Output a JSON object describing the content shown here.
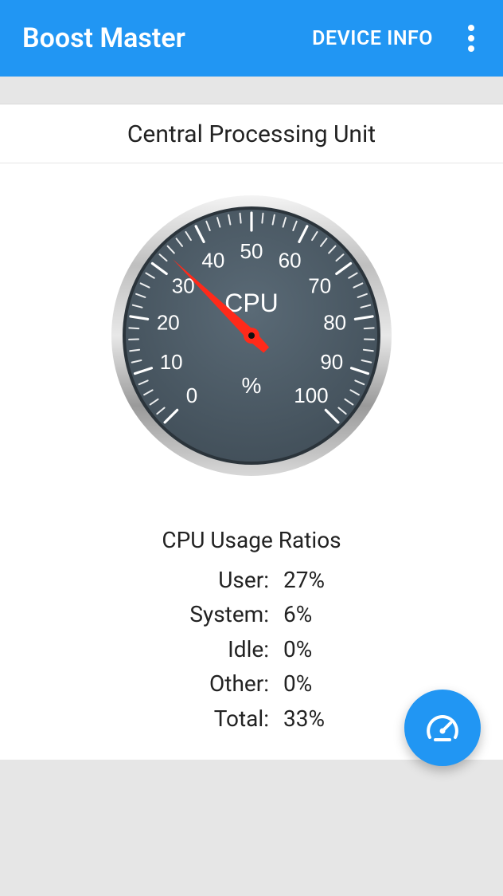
{
  "appbar": {
    "title": "Boost Master",
    "action_label": "DEVICE INFO"
  },
  "section": {
    "title": "Central Processing Unit"
  },
  "gauge": {
    "label": "CPU",
    "unit": "%",
    "value": 33,
    "min": 0,
    "max": 100,
    "ticks": [
      "0",
      "10",
      "20",
      "30",
      "40",
      "50",
      "60",
      "70",
      "80",
      "90",
      "100"
    ],
    "face_color": "#4a5863",
    "needle_color": "#ff2a1a",
    "tick_color": "#ffffff"
  },
  "ratios": {
    "title": "CPU Usage Ratios",
    "rows": [
      {
        "label": "User:",
        "value": "27%"
      },
      {
        "label": "System:",
        "value": "6%"
      },
      {
        "label": "Idle:",
        "value": "0%"
      },
      {
        "label": "Other:",
        "value": "0%"
      },
      {
        "label": "Total:",
        "value": "33%"
      }
    ]
  },
  "chart_data": {
    "type": "bar",
    "title": "CPU Usage Ratios",
    "categories": [
      "User",
      "System",
      "Idle",
      "Other",
      "Total"
    ],
    "values": [
      27,
      6,
      0,
      0,
      33
    ],
    "xlabel": "",
    "ylabel": "%",
    "ylim": [
      0,
      100
    ]
  }
}
